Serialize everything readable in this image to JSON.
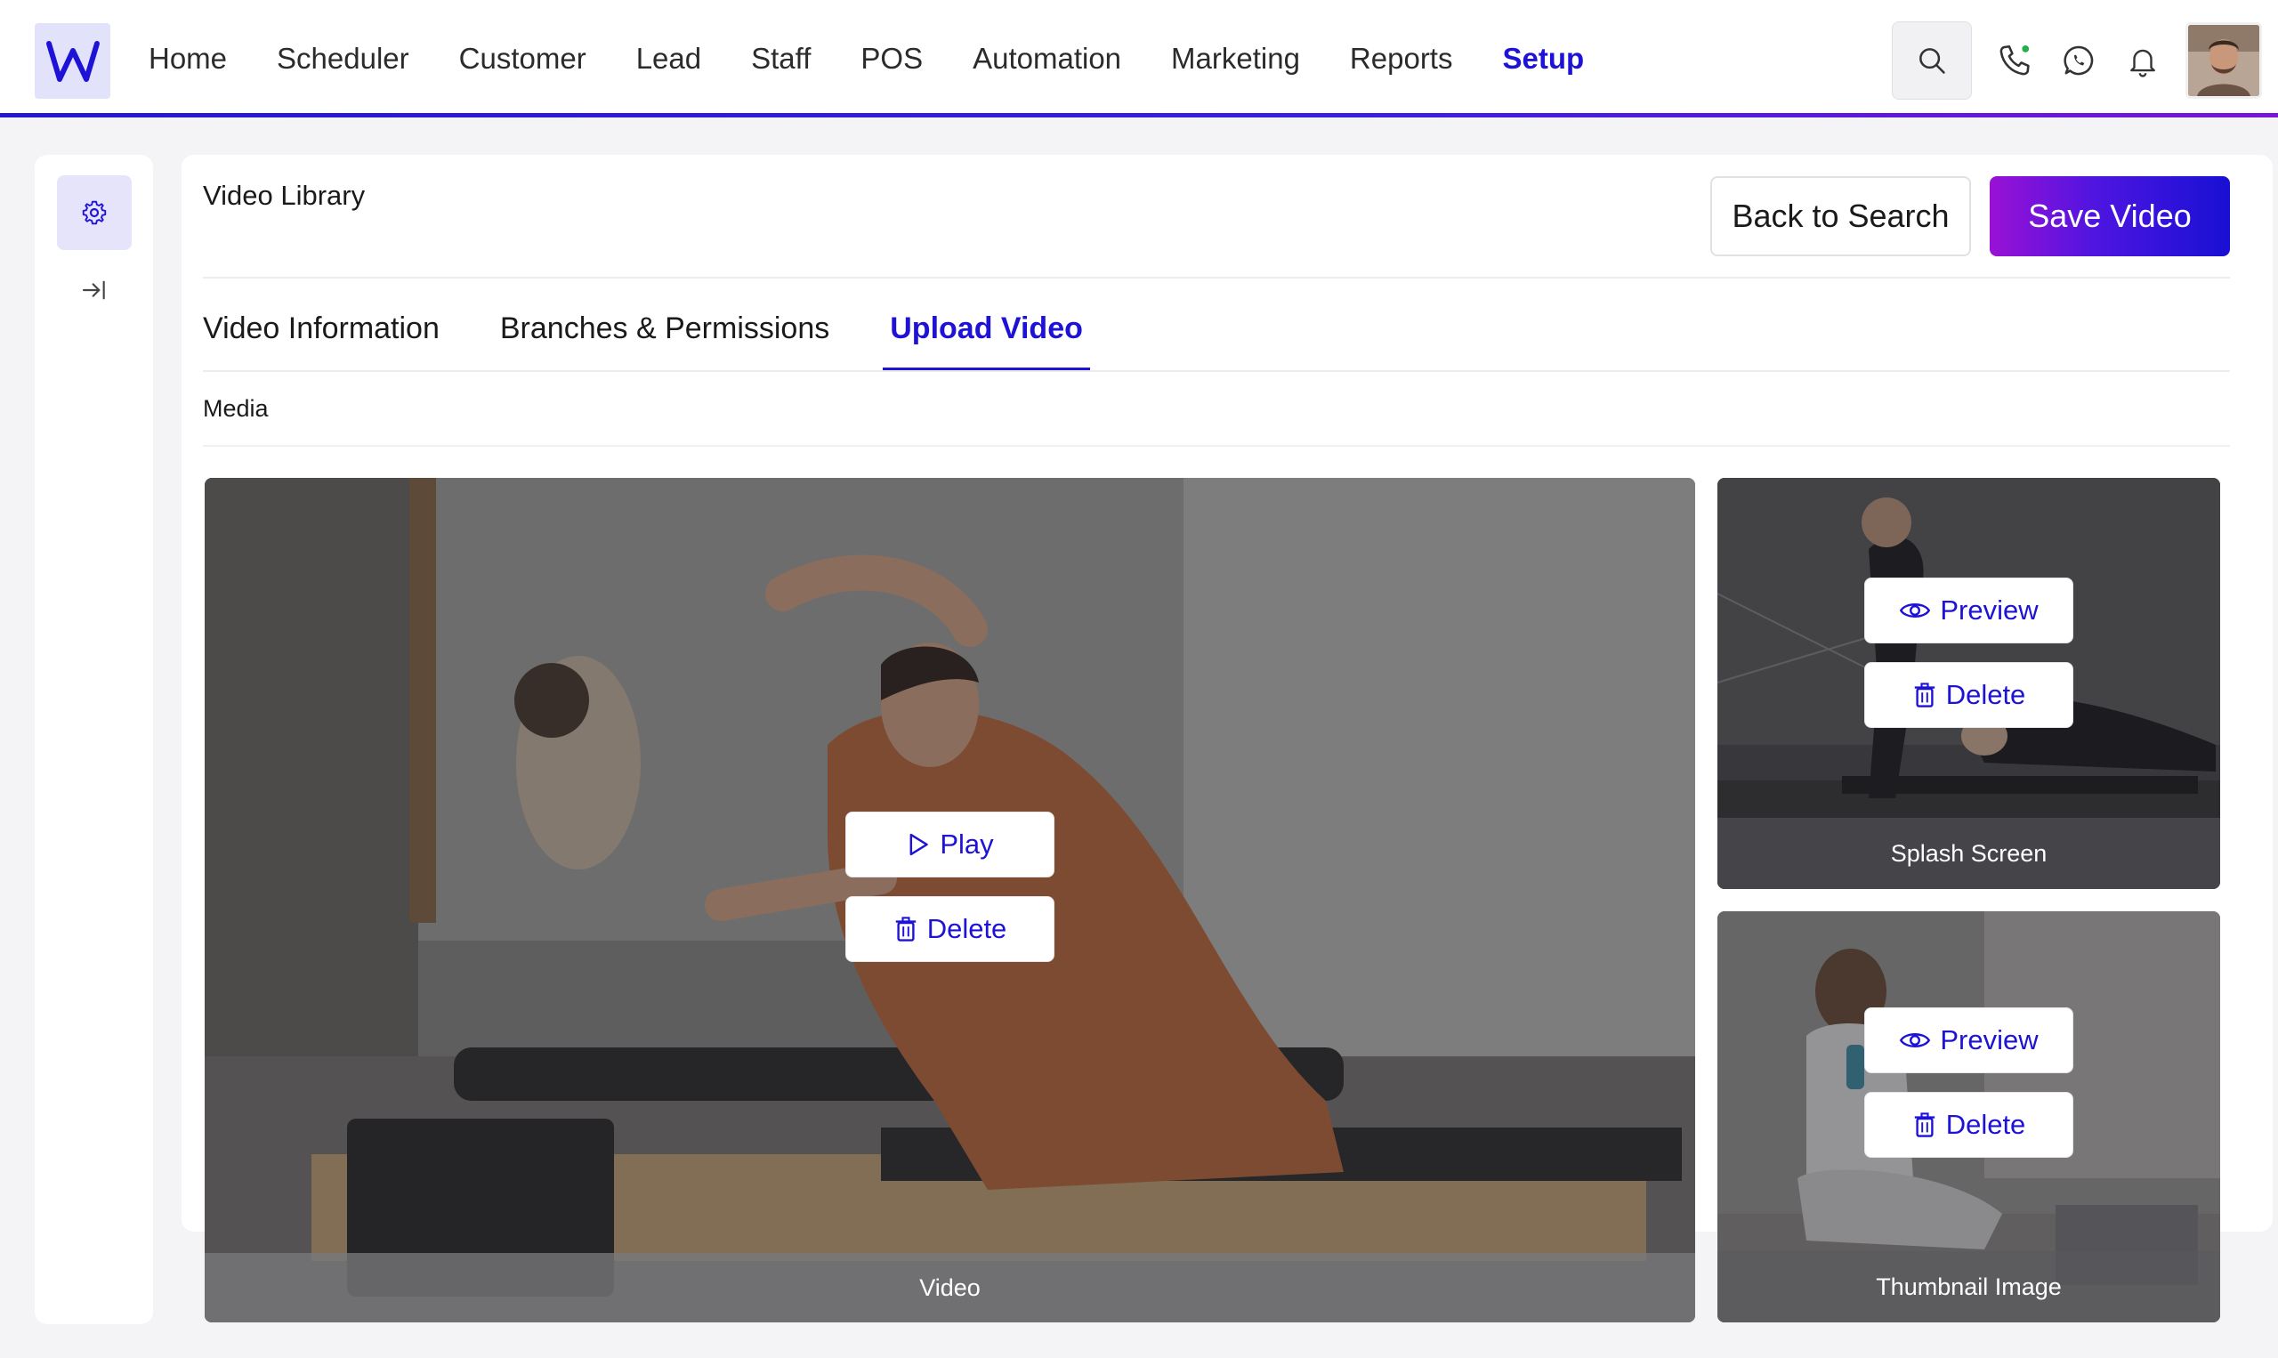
{
  "nav": {
    "logo_text": "W",
    "items": [
      {
        "label": "Home"
      },
      {
        "label": "Scheduler"
      },
      {
        "label": "Customer"
      },
      {
        "label": "Lead"
      },
      {
        "label": "Staff"
      },
      {
        "label": "POS"
      },
      {
        "label": "Automation"
      },
      {
        "label": "Marketing"
      },
      {
        "label": "Reports"
      },
      {
        "label": "Setup",
        "active": true
      }
    ],
    "icons": [
      "search-icon",
      "phone-icon",
      "whatsapp-icon",
      "bell-icon"
    ],
    "phone_status_color": "#22b04a"
  },
  "rail": {
    "icons": [
      "gear-icon",
      "collapse-arrow-icon"
    ]
  },
  "page": {
    "title": "Video Library",
    "back_label": "Back to Search",
    "save_label": "Save Video"
  },
  "tabs": [
    {
      "label": "Video Information"
    },
    {
      "label": "Branches & Permissions"
    },
    {
      "label": "Upload Video",
      "active": true
    }
  ],
  "section": {
    "label": "Media"
  },
  "media": {
    "video": {
      "caption": "Video",
      "play_label": "Play",
      "delete_label": "Delete"
    },
    "splash": {
      "caption": "Splash Screen",
      "preview_label": "Preview",
      "delete_label": "Delete"
    },
    "thumbnail": {
      "caption": "Thumbnail Image",
      "preview_label": "Preview",
      "delete_label": "Delete"
    }
  },
  "colors": {
    "accent": "#1d12d6",
    "save_gradient_start": "#9a11d6",
    "save_gradient_end": "#1810d4",
    "rail_active_bg": "#e5e4fa"
  }
}
